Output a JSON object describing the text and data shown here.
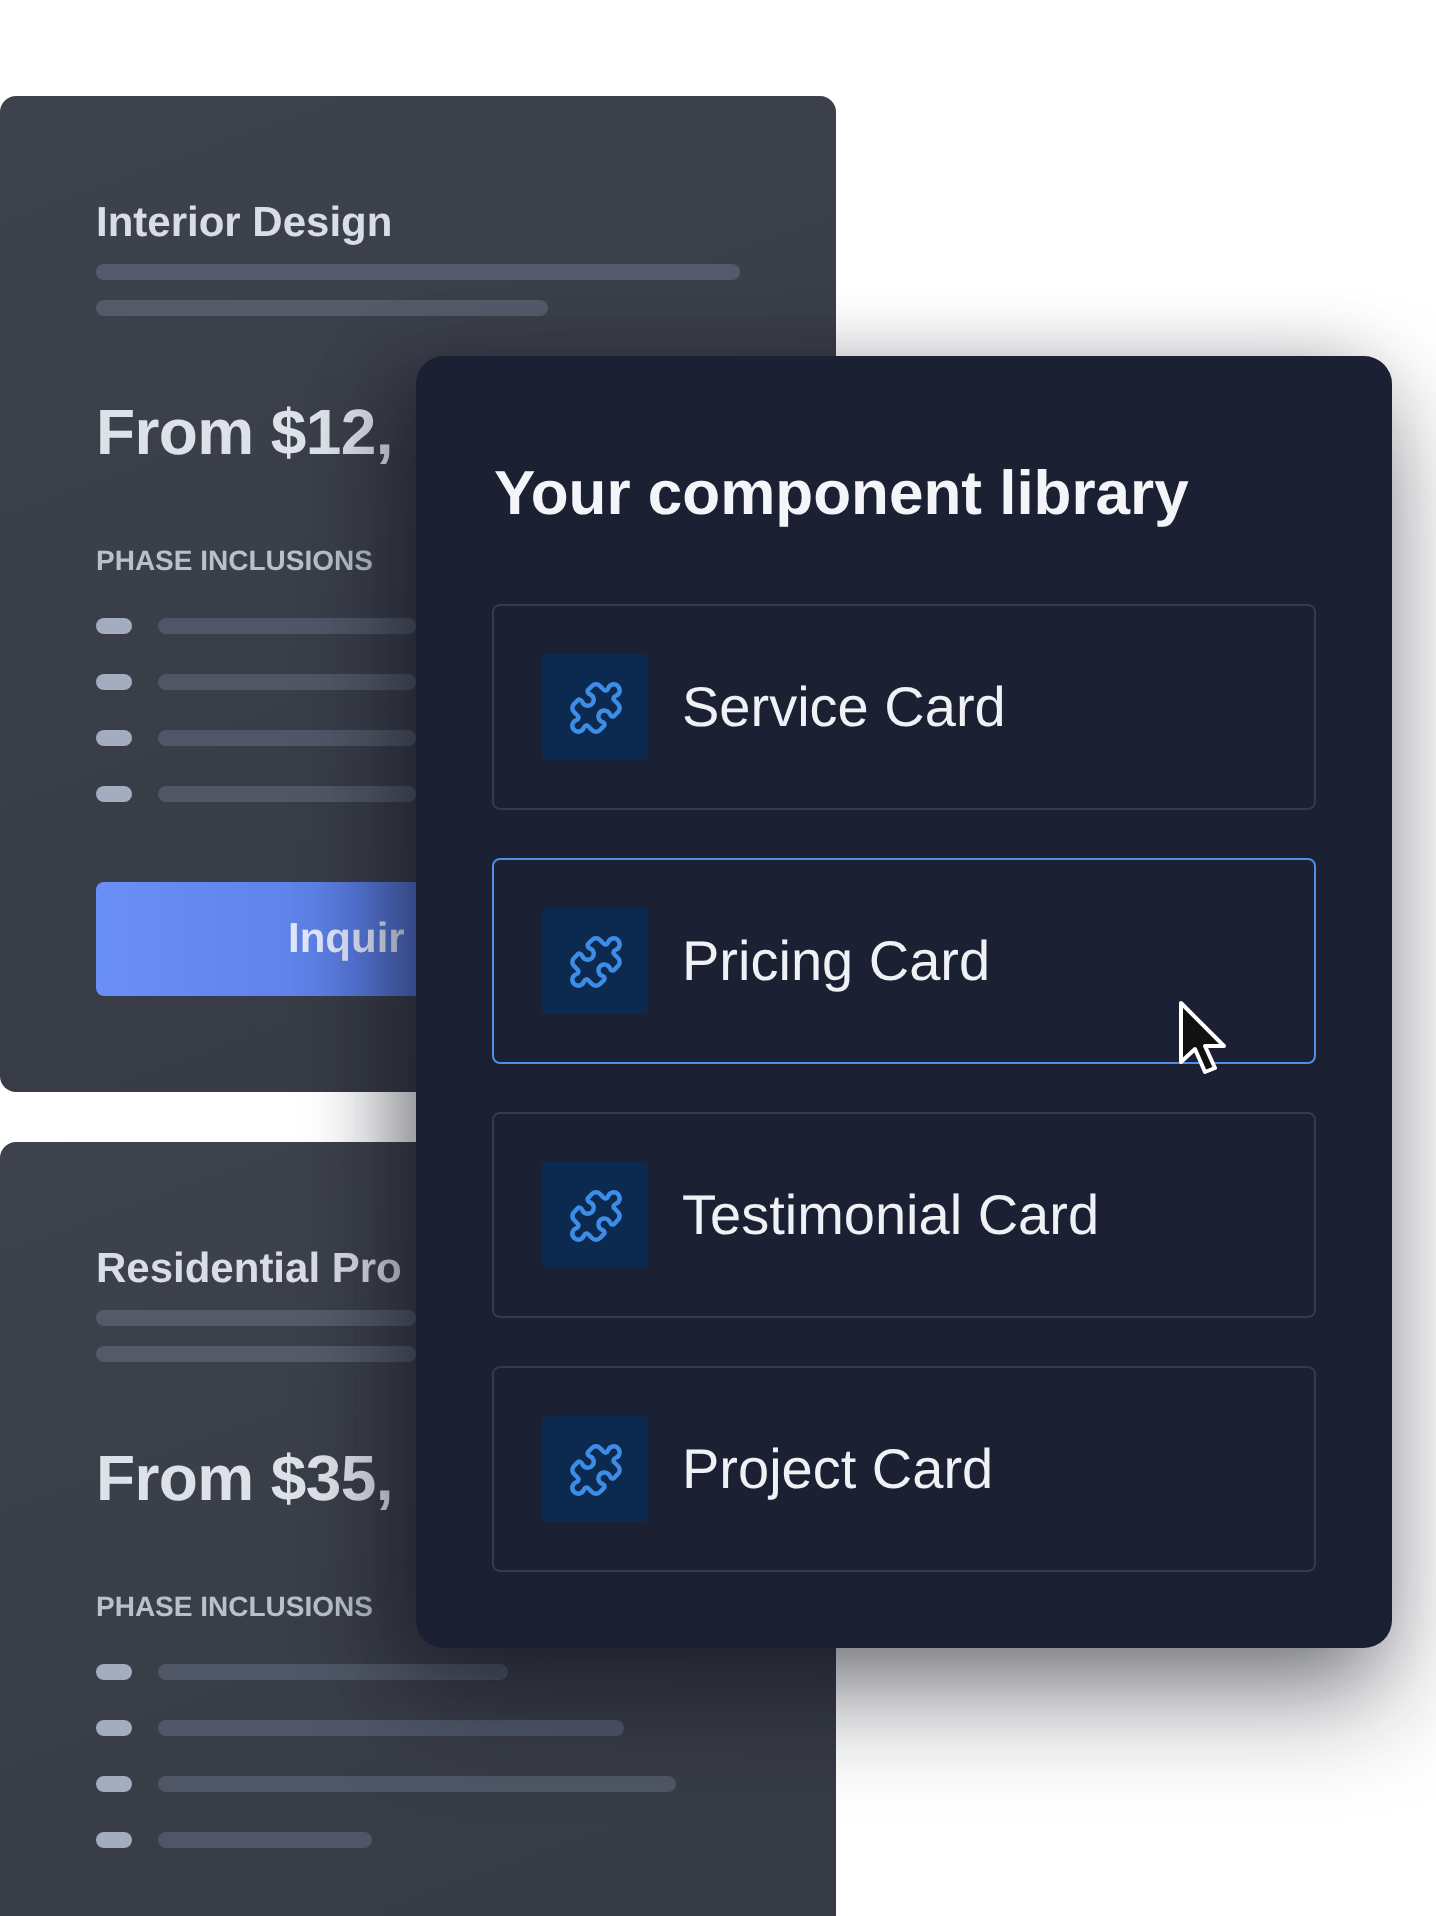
{
  "service_cards": [
    {
      "title": "Interior Design",
      "price": "From $12,",
      "section_label": "PHASE INCLUSIONS",
      "button": "Inquir"
    },
    {
      "title": "Residential Pro",
      "price": "From $35,",
      "section_label": "PHASE INCLUSIONS"
    }
  ],
  "library_panel": {
    "title": "Your component library",
    "items": [
      {
        "label": "Service Card",
        "selected": false
      },
      {
        "label": "Pricing Card",
        "selected": true
      },
      {
        "label": "Testimonial Card",
        "selected": false
      },
      {
        "label": "Project Card",
        "selected": false
      }
    ]
  }
}
